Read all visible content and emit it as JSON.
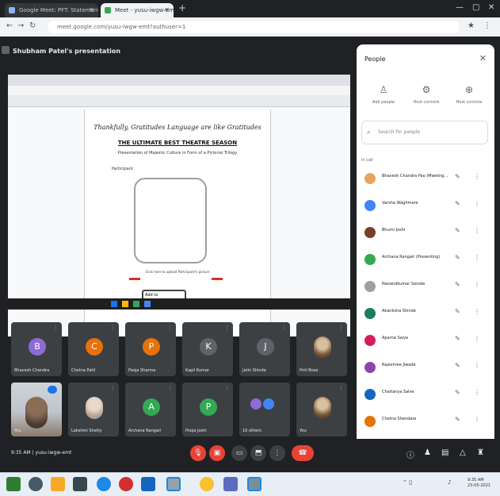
{
  "browser": {
    "tabs": [
      {
        "label": "Google Meet: PFT: Statements"
      },
      {
        "label": "Meet - yusu-iwgw-emt"
      }
    ],
    "url": "meet.google.com/yusu-iwgw-emt?authuser=1"
  },
  "meet": {
    "presenter_title": "Shubham Patel's presentation",
    "shared_doc": {
      "cursive_line": "Thankfully, Gratitudes Language are like Gratitudes",
      "heading": "THE ULTIMATE BEST THEATRE SEASON",
      "subheading": "Presentation of Majestic Culture in Form of a Pictorial Trilogy",
      "label": "Participant",
      "caption": "Click here to upload Participant's picture",
      "button_text": "Add to"
    },
    "tiles_row1": [
      {
        "name": "Bhavesh Chandra",
        "initial": "B",
        "color": "#8e6bd8"
      },
      {
        "name": "Chetna Patil",
        "initial": "C",
        "color": "#e8710a"
      },
      {
        "name": "Pooja Sharma",
        "initial": "P",
        "color": "#e8710a"
      },
      {
        "name": "Kapil Kumar",
        "initial": "K",
        "color": "#5f6368"
      },
      {
        "name": "Jatin Shinde",
        "initial": "J",
        "color": "#5f6368"
      },
      {
        "name": "Priti Bose",
        "initial": "",
        "color": "#7a5b3a"
      }
    ],
    "tiles_row2": [
      {
        "name": "You",
        "type": "self"
      },
      {
        "name": "Lakshmi Shetty",
        "initial": "",
        "type": "photo"
      },
      {
        "name": "Archana Rangari",
        "initial": "A",
        "color": "#34a853"
      },
      {
        "name": "Pooja Joshi",
        "initial": "P",
        "color": "#34a853"
      },
      {
        "name": "10 others",
        "initial": "",
        "type": "others"
      },
      {
        "name": "You",
        "initial": "",
        "type": "photo"
      }
    ],
    "bottom": {
      "time": "9:35 AM",
      "meeting_code": "yusu-iwgw-emt"
    }
  },
  "people_panel": {
    "title": "People",
    "actions": [
      {
        "label": "Add people",
        "icon": "person-add-icon"
      },
      {
        "label": "Host controls",
        "icon": "settings-icon"
      },
      {
        "label": "Host controls",
        "icon": "lock-icon"
      }
    ],
    "search_placeholder": "Search for people",
    "in_call_label": "In call",
    "participants": [
      {
        "name": "Bhavesh Chandra Pao (Meeting host)",
        "color": "#e8a45c"
      },
      {
        "name": "Varsha Waghmare",
        "color": "#4285f4"
      },
      {
        "name": "Bhumi Joshi",
        "color": "#7a3f2a"
      },
      {
        "name": "Archana Rangari (Presenting)",
        "color": "#34a853"
      },
      {
        "name": "Nanandkumar Sarode",
        "color": "#9aa0a6"
      },
      {
        "name": "Akanksha Shinde",
        "color": "#1a7f5a"
      },
      {
        "name": "Aparna Saiya",
        "color": "#d81b60"
      },
      {
        "name": "Rajeshree Jiwade",
        "color": "#8e44ad"
      },
      {
        "name": "Chaitanya Salve",
        "color": "#1565c0"
      },
      {
        "name": "Chetna Shendare",
        "color": "#e8710a"
      }
    ]
  },
  "colors": {
    "meet_bg": "#202124",
    "panel_bg": "#ffffff",
    "end_call": "#ea4335",
    "accent": "#1a73e8"
  },
  "taskbar": {
    "icons": [
      "windows-start-icon",
      "search-icon",
      "task-view-icon",
      "file-explorer-icon",
      "edge-icon",
      "opera-icon",
      "files-icon",
      "photos-icon",
      "chrome-icon",
      "notepad-icon",
      "app-icon"
    ],
    "tray_time": "9:35 AM",
    "tray_date": "23-05-2021"
  }
}
